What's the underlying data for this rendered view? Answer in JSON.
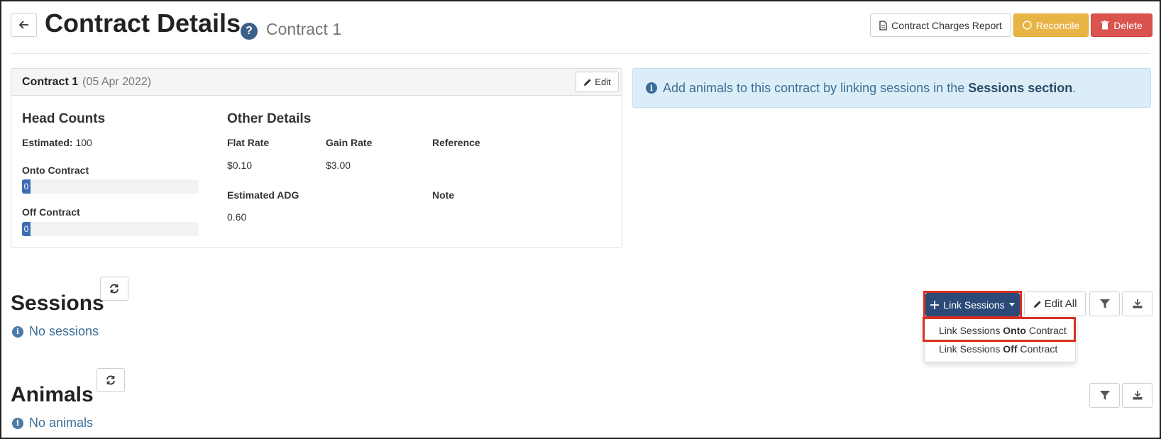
{
  "header": {
    "title": "Contract Details",
    "help": "?",
    "subtitle": "Contract 1",
    "actions": {
      "report": "Contract Charges Report",
      "reconcile": "Reconcile",
      "delete": "Delete"
    }
  },
  "contract": {
    "name": "Contract 1",
    "date": "(05 Apr 2022)",
    "edit": "Edit",
    "head_counts": {
      "title": "Head Counts",
      "estimated_label": "Estimated:",
      "estimated_value": "100",
      "onto_label": "Onto Contract",
      "onto_value": "0",
      "off_label": "Off Contract",
      "off_value": "0"
    },
    "other_details": {
      "title": "Other Details",
      "flat_rate_label": "Flat Rate",
      "flat_rate": "$0.10",
      "gain_rate_label": "Gain Rate",
      "gain_rate": "$3.00",
      "reference_label": "Reference",
      "adg_label": "Estimated ADG",
      "adg": "0.60",
      "note_label": "Note"
    }
  },
  "info": {
    "text": "Add animals to this contract by linking sessions in the",
    "link": "Sessions section",
    "end": "."
  },
  "sessions": {
    "title": "Sessions",
    "empty": "No sessions",
    "link_button": "Link Sessions",
    "edit_all": "Edit All",
    "menu": {
      "onto_pre": "Link Sessions ",
      "onto_bold": "Onto",
      "onto_post": " Contract",
      "off_pre": "Link Sessions ",
      "off_bold": "Off",
      "off_post": " Contract"
    }
  },
  "animals": {
    "title": "Animals",
    "empty": "No animals"
  },
  "colors": {
    "primary": "#2c4a78",
    "reconcile": "#e8b446",
    "delete": "#d9534f",
    "highlight": "#d9301e",
    "info_bg": "#dbeef8"
  }
}
